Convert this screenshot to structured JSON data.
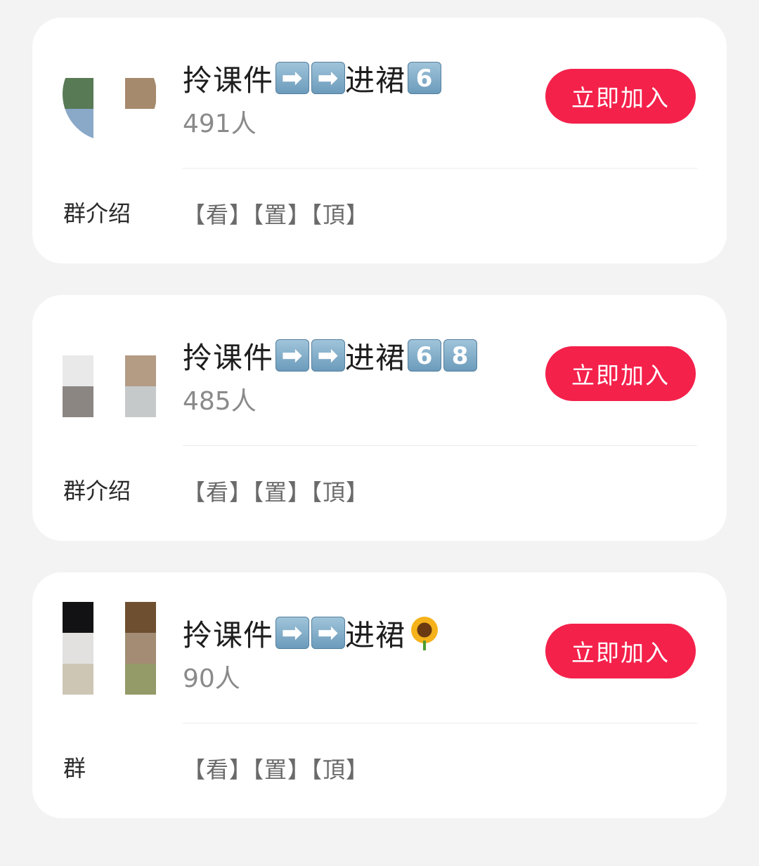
{
  "groups": [
    {
      "title": "拎课件",
      "title_suffix": "进裙",
      "badges": [
        "6"
      ],
      "members": "491人",
      "join_label": "立即加入",
      "intro_label": "群介绍",
      "intro_text": "【看】【置】【頂】",
      "avatar_colors": [
        "#587a55",
        "#a68a6d",
        "#8aa8c8"
      ]
    },
    {
      "title": "拎课件",
      "title_suffix": "进裙",
      "badges": [
        "6",
        "8"
      ],
      "members": "485人",
      "join_label": "立即加入",
      "intro_label": "群介绍",
      "intro_text": "【看】【置】【頂】",
      "avatar_colors": [
        "#e9e9e9",
        "#b49b84",
        "#8c8683",
        "#c5c9ca"
      ]
    },
    {
      "title": "拎课件",
      "title_suffix": "进裙",
      "badge_icon": "sunflower-icon",
      "members": "90人",
      "join_label": "立即加入",
      "intro_label": "群",
      "intro_text": "【看】【置】【頂】",
      "avatar_colors": [
        "#121214",
        "#6e4f30",
        "#e2e1df",
        "#a38c73",
        "#cdc6b5",
        "#949a68"
      ]
    }
  ],
  "arrow_icon": "right-arrow-key-icon",
  "arrow_glyph": "➡",
  "accent_color": "#f4214b"
}
